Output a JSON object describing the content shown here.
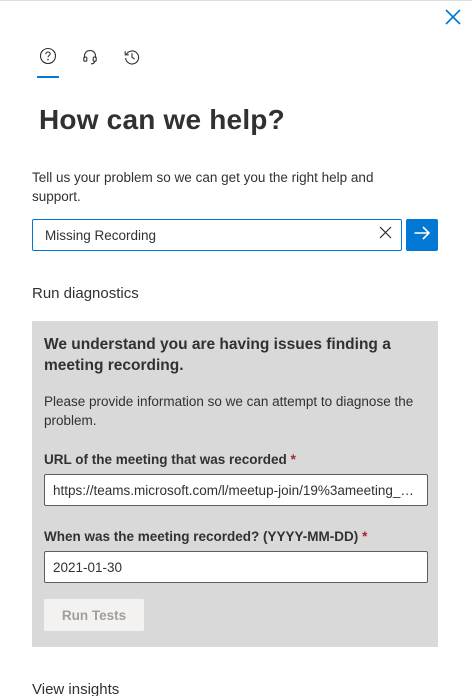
{
  "tabs": [
    {
      "name": "help",
      "icon": "question-circle-icon",
      "active": true
    },
    {
      "name": "contact-support",
      "icon": "headset-icon",
      "active": false
    },
    {
      "name": "history",
      "icon": "history-icon",
      "active": false
    }
  ],
  "header": {
    "title": "How can we help?"
  },
  "intro": {
    "text": "Tell us your problem so we can get you the right help and support."
  },
  "search": {
    "value": "Missing Recording"
  },
  "diagnostics": {
    "section_title": "Run diagnostics",
    "heading": "We understand you are having issues finding a meeting recording.",
    "description": "Please provide information so we can attempt to diagnose the problem.",
    "url_label": "URL of the meeting that was recorded",
    "url_value": "https://teams.microsoft.com/l/meetup-join/19%3ameeting_example",
    "date_label": "When was the meeting recorded? (YYYY-MM-DD)",
    "date_value": "2021-01-30",
    "required_marker": "*",
    "run_button": "Run Tests",
    "run_button_enabled": false
  },
  "insights": {
    "section_title": "View insights"
  },
  "colors": {
    "accent": "#0078d4",
    "diag_background": "#d9d9d9",
    "required": "#a4262c",
    "text": "#323130"
  }
}
